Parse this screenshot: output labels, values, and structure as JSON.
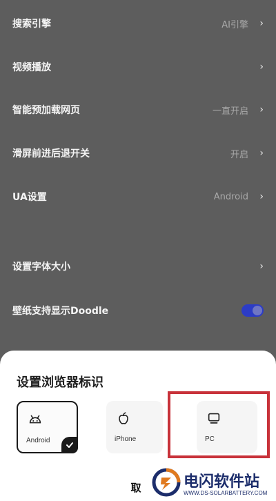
{
  "settings": [
    {
      "label": "搜索引擎",
      "value": "AI引擎"
    },
    {
      "label": "视频播放",
      "value": ""
    },
    {
      "label": "智能预加载网页",
      "value": "一直开启"
    },
    {
      "label": "滑屏前进后退开关",
      "value": "开启"
    },
    {
      "label": "UA设置",
      "value": "Android"
    },
    {
      "label": "设置字体大小",
      "value": ""
    },
    {
      "label": "壁纸支持显示Doodle",
      "toggle_on": true
    }
  ],
  "sheet": {
    "title": "设置浏览器标识",
    "options": [
      {
        "label": "Android",
        "icon": "android-icon",
        "selected": true
      },
      {
        "label": "iPhone",
        "icon": "apple-icon",
        "selected": false
      },
      {
        "label": "PC",
        "icon": "monitor-icon",
        "selected": false
      }
    ],
    "cancel_label": "取"
  },
  "watermark": {
    "name": "电闪软件站",
    "url": "WWW.DS-SOLARBATTERY.COM"
  },
  "colors": {
    "overlay_bg": "#5d5d5d",
    "toggle_on": "#2c3cc6",
    "highlight": "#c8323a"
  }
}
